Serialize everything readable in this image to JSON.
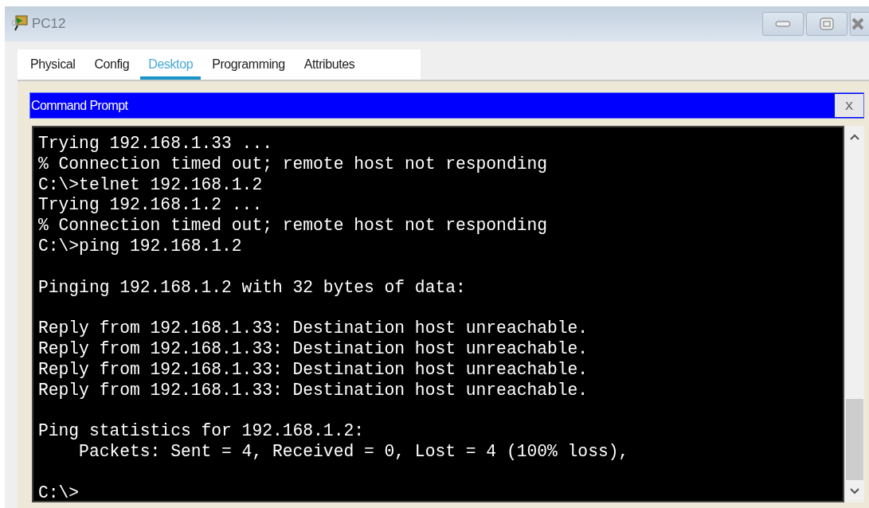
{
  "window": {
    "title": "PC12"
  },
  "tabs": [
    {
      "label": "Physical",
      "selected": false
    },
    {
      "label": "Config",
      "selected": false
    },
    {
      "label": "Desktop",
      "selected": true
    },
    {
      "label": "Programming",
      "selected": false
    },
    {
      "label": "Attributes",
      "selected": false
    }
  ],
  "app": {
    "title": "Command Prompt",
    "close_label": "X"
  },
  "terminal": {
    "blocks": [
      [
        "Trying 192.168.1.33 ...",
        "% Connection timed out; remote host not responding",
        "C:\\>telnet 192.168.1.2",
        "Trying 192.168.1.2 ...",
        "% Connection timed out; remote host not responding",
        "C:\\>ping 192.168.1.2"
      ],
      [
        "Pinging 192.168.1.2 with 32 bytes of data:"
      ],
      [
        "Reply from 192.168.1.33: Destination host unreachable.",
        "Reply from 192.168.1.33: Destination host unreachable.",
        "Reply from 192.168.1.33: Destination host unreachable.",
        "Reply from 192.168.1.33: Destination host unreachable."
      ],
      [
        "Ping statistics for 192.168.1.2:",
        "    Packets: Sent = 4, Received = 0, Lost = 4 (100% loss),"
      ],
      [
        "C:\\>"
      ]
    ]
  }
}
